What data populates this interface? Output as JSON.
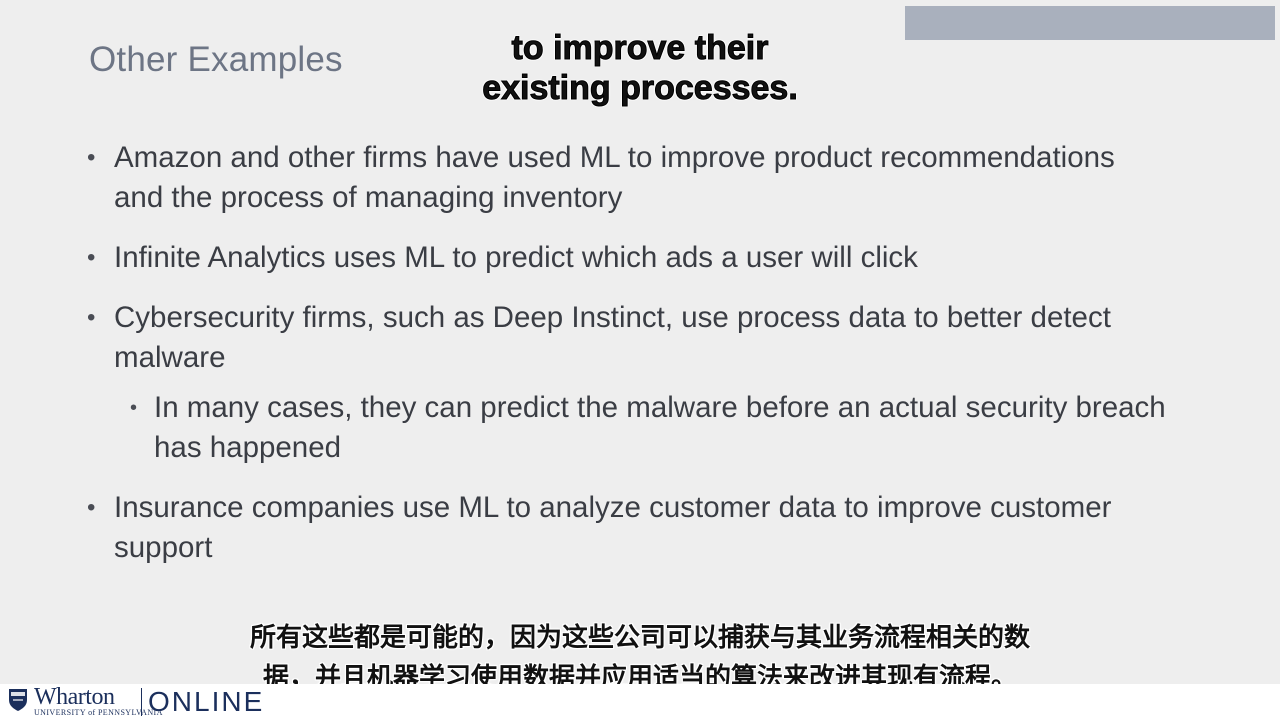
{
  "slide": {
    "title": "Other Examples",
    "bullets": [
      {
        "text": "Amazon and other firms have used ML to improve product recommendations and the process of managing inventory"
      },
      {
        "text": "Infinite Analytics uses ML to predict which ads a user will click"
      },
      {
        "text": "Cybersecurity firms, such as Deep Instinct, use process data to better detect malware",
        "sub": "In many cases, they can predict the malware before an actual security breach has happened"
      },
      {
        "text": "Insurance companies use ML to analyze customer data to improve customer support"
      }
    ]
  },
  "captions": {
    "english_line1": "to improve their",
    "english_line2": "existing processes.",
    "chinese_line1": "所有这些都是可能的，因为这些公司可以捕获与其业务流程相关的数",
    "chinese_line2": "据，并且机器学习使用数据并应用适当的算法来改进其现有流程。"
  },
  "footer": {
    "logo_wharton": "Wharton",
    "logo_sub": "UNIVERSITY of PENNSYLVANIA",
    "logo_online": "ONLINE"
  },
  "colors": {
    "background": "#eeeeee",
    "title": "#6d7585",
    "body_text": "#3a3d44",
    "corner_block": "#a9b0bd",
    "wharton_navy": "#1b2f5c"
  },
  "icons": [
    "wharton-shield-icon"
  ]
}
